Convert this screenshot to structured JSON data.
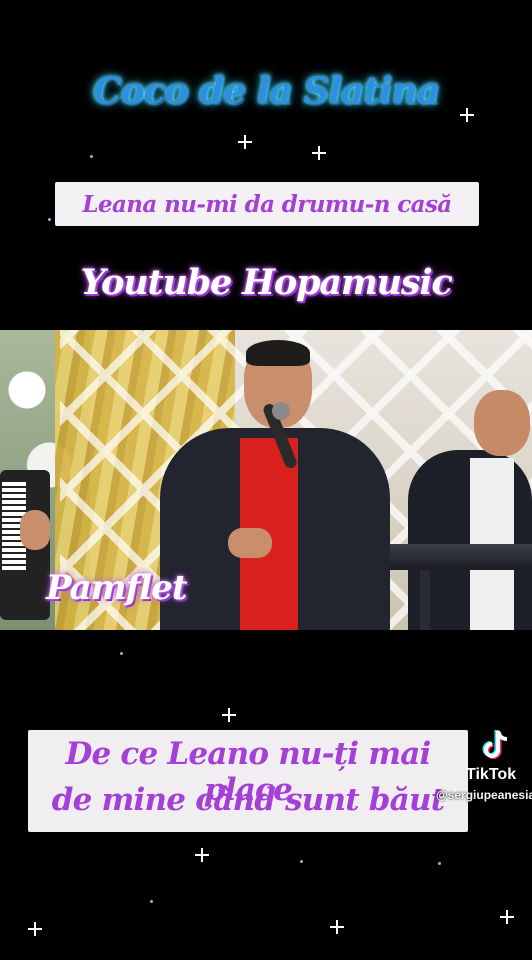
{
  "header": {
    "title": "Coco de la Slatina",
    "song_label": "Leana nu-mi da drumu-n casă",
    "channel": "Youtube Hopamusic"
  },
  "video": {
    "tag": "Pamflet"
  },
  "caption": {
    "line1": "De ce Leano nu-ți mai place",
    "line2": "de mine când sunt băut"
  },
  "watermark": {
    "platform": "TikTok",
    "icon": "tiktok-logo-icon",
    "handle": "@sergiupeanesia"
  },
  "colors": {
    "title_glow": "#29d3ff",
    "purple_text": "#a53fd6",
    "background": "#000000"
  }
}
